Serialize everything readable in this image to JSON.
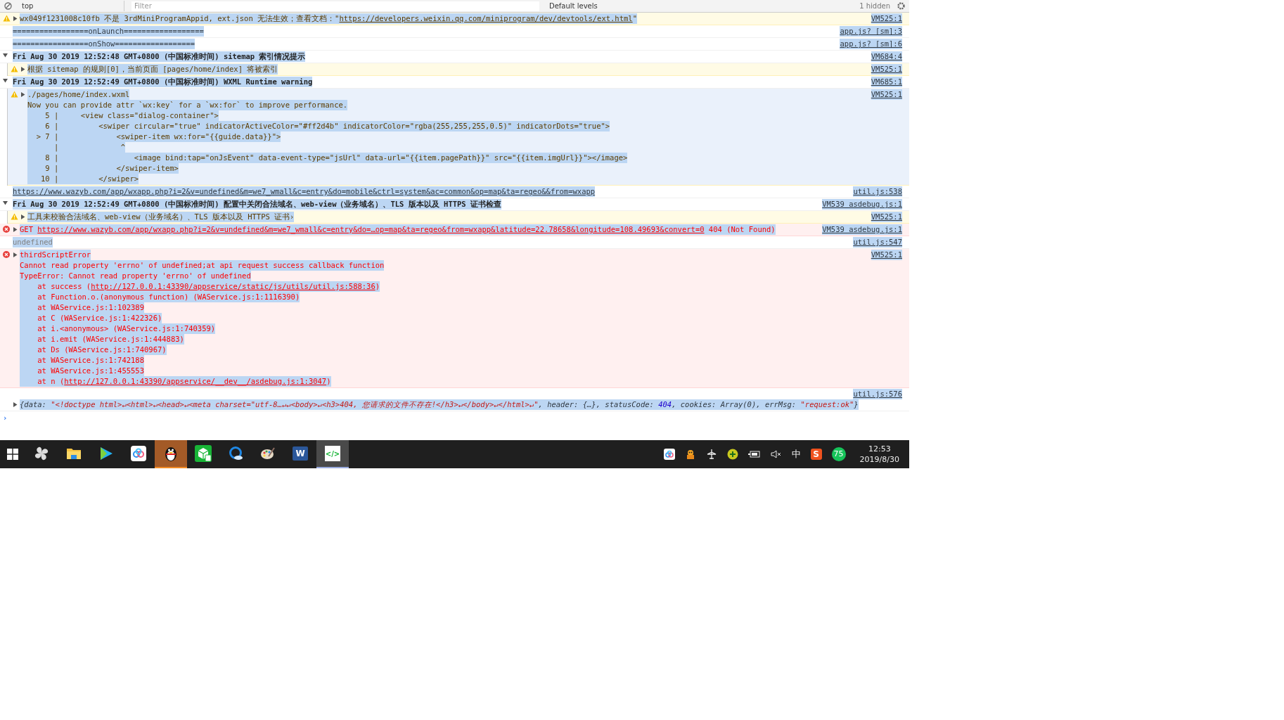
{
  "toolbar": {
    "context": "top",
    "filter": {
      "placeholder": "Filter"
    },
    "levels": "Default levels",
    "hidden_count": "1 hidden"
  },
  "messages": [
    {
      "kind": "warning",
      "selected": false,
      "expanded": false,
      "source": "VM525:1",
      "lines": [
        [
          {
            "text": "wx049f1231008c10fb 不是 3rdMiniProgramAppid, ext.json 无法生效；查看文档：\""
          },
          {
            "kind": "link",
            "text": "https://developers.weixin.qq.com/miniprogram/dev/devtools/ext.html"
          },
          {
            "text": "\""
          }
        ]
      ]
    },
    {
      "kind": "log",
      "selected": false,
      "source": "app.js? [sm]:3",
      "lines": [
        [
          {
            "text": "=================onLaunch=================="
          }
        ]
      ]
    },
    {
      "kind": "log",
      "selected": false,
      "source": "app.js? [sm]:6",
      "lines": [
        [
          {
            "text": "=================onShow=================="
          }
        ]
      ]
    },
    {
      "kind": "group",
      "selected": false,
      "expanded": true,
      "source": "VM684:4",
      "lines": [
        [
          {
            "text": "Fri Aug 30 2019 12:52:48 GMT+0800 (中国标准时间) sitemap 索引情况提示"
          }
        ]
      ],
      "children": [
        {
          "kind": "warning",
          "selected": false,
          "expanded": false,
          "source": "VM525:1",
          "lines": [
            [
              {
                "text": "根据 sitemap 的规则[0]，当前页面 [pages/home/index] 将被索引"
              }
            ]
          ]
        }
      ]
    },
    {
      "kind": "group",
      "selected": false,
      "expanded": true,
      "source": "VM685:1",
      "lines": [
        [
          {
            "text": "Fri Aug 30 2019 12:52:49 GMT+0800 (中国标准时间) WXML Runtime warning"
          }
        ]
      ],
      "children": [
        {
          "kind": "warning",
          "selected": true,
          "expanded": false,
          "source": "VM525:1",
          "lines": [
            [
              {
                "text": "./pages/home/index.wxml"
              }
            ],
            [
              {
                "text": "Now you can provide attr `wx:key` for a `wx:for` to improve performance."
              }
            ],
            [
              {
                "text": "    5 |     <view class=\"dialog-container\">"
              }
            ],
            [
              {
                "text": "    6 |         <swiper circular=\"true\" indicatorActiveColor=\"#ff2d4b\" indicatorColor=\"rgba(255,255,255,0.5)\" indicatorDots=\"true\">"
              }
            ],
            [
              {
                "text": "  > 7 |             <swiper-item wx:for=\"{{guide.data}}\">"
              }
            ],
            [
              {
                "text": "      |              ^"
              }
            ],
            [
              {
                "text": "    8 |                 <image bind:tap=\"onJsEvent\" data-event-type=\"jsUrl\" data-url=\"{{item.pagePath}}\" src=\"{{item.imgUrl}}\"></image>"
              }
            ],
            [
              {
                "text": "    9 |             </swiper-item>"
              }
            ],
            [
              {
                "text": "   10 |         </swiper>"
              }
            ]
          ]
        }
      ]
    },
    {
      "kind": "log",
      "selected": false,
      "source": "util.js:538",
      "lines": [
        [
          {
            "kind": "link",
            "text": "https://www.wazyb.com/app/wxapp.php?i=2&v=undefined&m=we7_wmall&c=entry&do=mobile&ctrl=system&ac=common&op=map&ta=regeo&&from=wxapp"
          }
        ]
      ]
    },
    {
      "kind": "group",
      "selected": false,
      "expanded": true,
      "source": "VM539 asdebug.js:1",
      "lines": [
        [
          {
            "text": "Fri Aug 30 2019 12:52:49 GMT+0800 (中国标准时间) 配置中关闭合法域名、web-view（业务域名）、TLS 版本以及 HTTPS 证书检查"
          }
        ]
      ],
      "children": [
        {
          "kind": "warning",
          "selected": false,
          "expanded": false,
          "source": "VM525:1",
          "lines": [
            [
              {
                "text": "工具未校验合法域名、web-view（业务域名）、TLS 版本以及 HTTPS 证书›"
              }
            ]
          ]
        }
      ]
    },
    {
      "kind": "error",
      "selected": false,
      "expanded": false,
      "source": "VM539 asdebug.js:1",
      "lines": [
        [
          {
            "text": "GET "
          },
          {
            "kind": "link",
            "text": "https://www.wazyb.com/app/wxapp.php?i=2&v=undefined&m=we7_wmall&c=entry&do=…op=map&ta=regeo&from=wxapp&latitude=22.78658&longitude=108.49693&convert=0"
          },
          {
            "text": " 404 (Not Found)"
          }
        ]
      ]
    },
    {
      "kind": "log",
      "selected": false,
      "source": "util.js:547",
      "lines": [
        [
          {
            "kind": "grey",
            "text": "undefined"
          }
        ]
      ]
    },
    {
      "kind": "error",
      "selected": false,
      "expanded": false,
      "source": "VM525:1",
      "lines": [
        [
          {
            "text": "thirdScriptError"
          }
        ],
        [
          {
            "text": "Cannot read property 'errno' of undefined;at api request success callback function"
          }
        ],
        [
          {
            "text": "TypeError: Cannot read property 'errno' of undefined"
          }
        ],
        [
          {
            "text": "    at success ("
          },
          {
            "kind": "link",
            "text": "http://127.0.0.1:43390/appservice/static/js/utils/util.js:588:36"
          },
          {
            "text": ")"
          }
        ],
        [
          {
            "text": "    at Function.o.(anonymous function) (WAService.js:1:1116390)"
          }
        ],
        [
          {
            "text": "    at WAService.js:1:102389"
          }
        ],
        [
          {
            "text": "    at C (WAService.js:1:422326)"
          }
        ],
        [
          {
            "text": "    at i.<anonymous> (WAService.js:1:740359)"
          }
        ],
        [
          {
            "text": "    at i.emit (WAService.js:1:444883)"
          }
        ],
        [
          {
            "text": "    at Ds (WAService.js:1:740967)"
          }
        ],
        [
          {
            "text": "    at WAService.js:1:742188"
          }
        ],
        [
          {
            "text": "    at WAService.js:1:455553"
          }
        ],
        [
          {
            "text": "    at n ("
          },
          {
            "kind": "link",
            "text": "http://127.0.0.1:43390/appservice/__dev__/asdebug.js:1:3047"
          },
          {
            "text": ")"
          }
        ]
      ]
    },
    {
      "kind": "object",
      "selected": false,
      "expanded": false,
      "source": "util.js:576",
      "lines": [
        [
          {
            "text": "{data: "
          },
          {
            "kind": "string",
            "text": "\"<!doctype html>↵<html>↵<head>↵<meta charset=\"utf-8…↵↵<body>↵<h3>404, 您请求的文件不存在!</h3>↵</body>↵</html>↵\""
          },
          {
            "text": ", header: {…}, statusCode: "
          },
          {
            "kind": "number",
            "text": "404"
          },
          {
            "text": ", cookies: Array(0), errMsg: "
          },
          {
            "kind": "string",
            "text": "\"request:ok\""
          },
          {
            "text": "}"
          }
        ]
      ]
    }
  ],
  "prompt": "›",
  "taskbar": {
    "apps": [
      {
        "kind": "pinwheel",
        "active": false,
        "flashing": false
      },
      {
        "kind": "folder",
        "active": false,
        "flashing": false
      },
      {
        "kind": "video",
        "active": false,
        "flashing": false
      },
      {
        "kind": "cloud",
        "active": false,
        "flashing": false
      },
      {
        "kind": "penguin",
        "active": false,
        "flashing": true
      },
      {
        "kind": "devtool",
        "active": false,
        "flashing": false
      },
      {
        "kind": "browser",
        "active": false,
        "flashing": false
      },
      {
        "kind": "palette",
        "active": false,
        "flashing": false
      },
      {
        "kind": "word",
        "glyph": "W",
        "active": false,
        "flashing": false
      },
      {
        "kind": "code",
        "glyph": "</>",
        "active": true,
        "flashing": false
      }
    ],
    "tray": [
      {
        "kind": "cloud"
      },
      {
        "kind": "pet"
      },
      {
        "kind": "airplane"
      },
      {
        "kind": "plus"
      },
      {
        "kind": "battery"
      },
      {
        "kind": "muted"
      },
      {
        "kind": "ime",
        "glyph": "中"
      },
      {
        "kind": "sogou",
        "glyph": "S"
      },
      {
        "kind": "badge",
        "glyph": "75"
      }
    ],
    "time": "12:53",
    "date": "2019/8/30"
  }
}
